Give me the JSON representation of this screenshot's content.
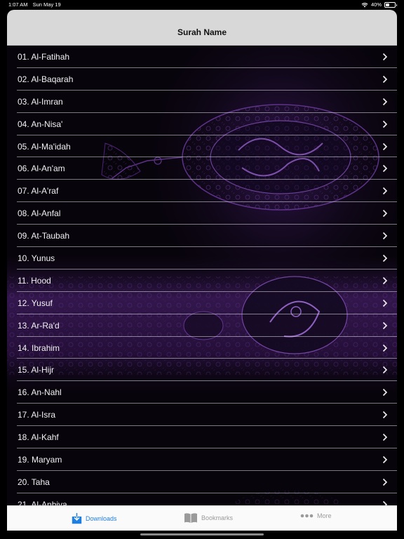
{
  "status_bar": {
    "time": "1:07 AM",
    "date": "Sun May 19",
    "battery": "40%",
    "battery_level": 0.4
  },
  "nav": {
    "title": "Surah Name"
  },
  "surahs": [
    "01. Al-Fatihah",
    "02. Al-Baqarah",
    "03. Al-Imran",
    "04. An-Nisa'",
    "05. Al-Ma'idah",
    "06. Al-An'am",
    "07. Al-A'raf",
    "08. Al-Anfal",
    "09. At-Taubah",
    "10. Yunus",
    "11. Hood",
    "12. Yusuf",
    "13. Ar-Ra'd",
    "14. Ibrahim",
    "15. Al-Hijr",
    "16. An-Nahl",
    "17. Al-Isra",
    "18. Al-Kahf",
    "19. Maryam",
    "20. Taha",
    "21. Al-Anbiya"
  ],
  "tabs": [
    {
      "label": "Downloads",
      "icon": "download-icon",
      "active": true
    },
    {
      "label": "Bookmarks",
      "icon": "book-icon",
      "active": false
    },
    {
      "label": "More",
      "icon": "more-dots-icon",
      "active": false
    }
  ],
  "colors": {
    "accent": "#1f7fe0",
    "inactive": "#9a9a9a",
    "nav_bg": "#d8d8d8",
    "art_purple": "#5a2a8a"
  }
}
